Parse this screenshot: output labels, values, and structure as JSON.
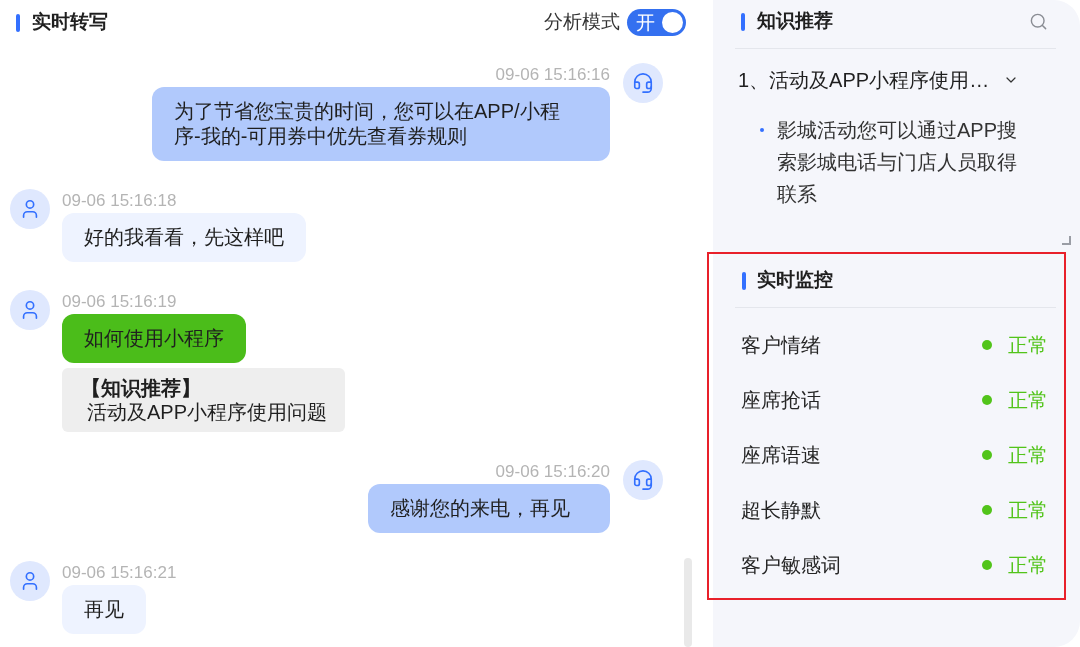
{
  "transcript": {
    "title": "实时转写",
    "analysis_mode": {
      "label": "分析模式",
      "toggle_text": "开",
      "on": true
    }
  },
  "messages": [
    {
      "kind": "agent",
      "time": "09-06 15:16:16",
      "text": "为了节省您宝贵的时间，您可以在APP/小程序-我的-可用券中优先查看券规则",
      "highlighted": false
    },
    {
      "kind": "customer",
      "time": "09-06 15:16:18",
      "text": "好的我看看，先这样吧",
      "highlighted": false
    },
    {
      "kind": "customer",
      "time": "09-06 15:16:19",
      "text": "如何使用小程序",
      "highlighted": true,
      "knowledge": {
        "title": "【知识推荐】",
        "text": "活动及APP小程序使用问题"
      }
    },
    {
      "kind": "agent",
      "time": "09-06 15:16:20",
      "text": "感谢您的来电，再见",
      "highlighted": false
    },
    {
      "kind": "customer",
      "time": "09-06 15:16:21",
      "text": "再见",
      "highlighted": false
    }
  ],
  "knowledge": {
    "title": "知识推荐",
    "items": [
      {
        "title": "1、活动及APP小程序使用…",
        "expanded": true,
        "details": [
          "影城活动您可以通过APP搜索影城电话与门店人员取得联系"
        ]
      }
    ]
  },
  "monitor": {
    "title": "实时监控",
    "highlighted": true,
    "items": [
      {
        "label": "客户情绪",
        "status": "正常",
        "color": "#52c41a"
      },
      {
        "label": "座席抢话",
        "status": "正常",
        "color": "#52c41a"
      },
      {
        "label": "座席语速",
        "status": "正常",
        "color": "#52c41a"
      },
      {
        "label": "超长静默",
        "status": "正常",
        "color": "#52c41a"
      },
      {
        "label": "客户敏感词",
        "status": "正常",
        "color": "#52c41a"
      }
    ]
  }
}
